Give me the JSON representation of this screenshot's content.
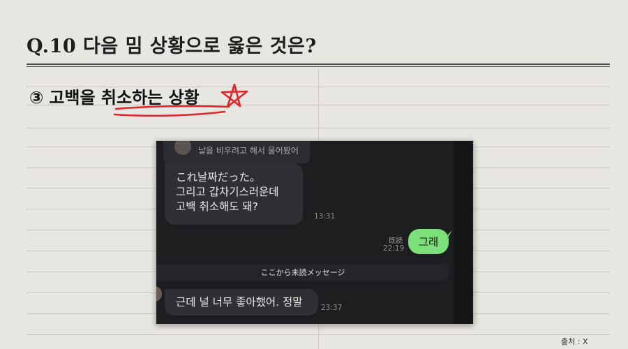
{
  "title": "Q.10 다음 밈 상황으로 옳은 것은?",
  "answer": {
    "number": "③",
    "text": "고백을 취소하는 상황"
  },
  "chat": {
    "reply_preview": "날을 비우려고 해서 물어봤어",
    "incoming_message_lines": [
      "これ날짜だった。",
      "그리고 갑차기스러운데",
      "고백 취소해도 돼?"
    ],
    "incoming_time": "13:31",
    "read_label": "既読",
    "outgoing_time": "22:19",
    "outgoing_message": "그래",
    "unread_divider": "ここから未読メッセージ",
    "last_message": "근데 널 너무 좋아했어. 정말",
    "last_time": "23:37"
  },
  "source": "출처 : X",
  "colors": {
    "background": "#e8e6e1",
    "outgoing_bubble": "#7be07a",
    "annotation_red": "#e0242a"
  }
}
